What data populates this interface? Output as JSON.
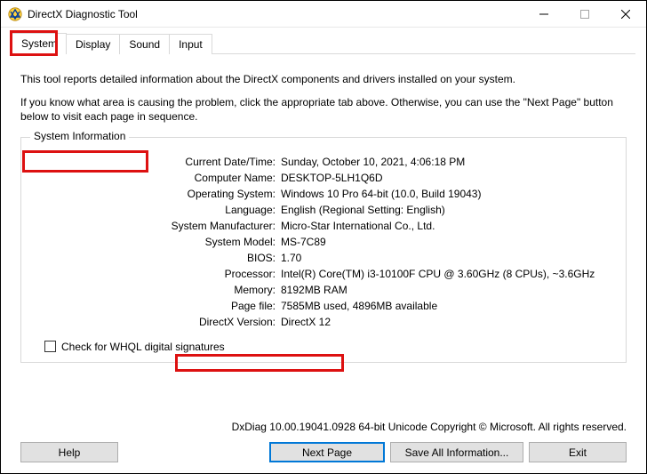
{
  "title": "DirectX Diagnostic Tool",
  "tabs": [
    "System",
    "Display",
    "Sound",
    "Input"
  ],
  "intro": {
    "p1": "This tool reports detailed information about the DirectX components and drivers installed on your system.",
    "p2": "If you know what area is causing the problem, click the appropriate tab above.  Otherwise, you can use the \"Next Page\" button below to visit each page in sequence."
  },
  "group": {
    "legend": "System Information"
  },
  "info": [
    {
      "label": "Current Date/Time:",
      "value": "Sunday, October 10, 2021, 4:06:18 PM"
    },
    {
      "label": "Computer Name:",
      "value": "DESKTOP-5LH1Q6D"
    },
    {
      "label": "Operating System:",
      "value": "Windows 10 Pro 64-bit (10.0, Build 19043)"
    },
    {
      "label": "Language:",
      "value": "English (Regional Setting: English)"
    },
    {
      "label": "System Manufacturer:",
      "value": "Micro-Star International Co., Ltd."
    },
    {
      "label": "System Model:",
      "value": "MS-7C89"
    },
    {
      "label": "BIOS:",
      "value": "1.70"
    },
    {
      "label": "Processor:",
      "value": "Intel(R) Core(TM) i3-10100F CPU @ 3.60GHz (8 CPUs), ~3.6GHz"
    },
    {
      "label": "Memory:",
      "value": "8192MB RAM"
    },
    {
      "label": "Page file:",
      "value": "7585MB used, 4896MB available"
    },
    {
      "label": "DirectX Version:",
      "value": "DirectX 12"
    }
  ],
  "checkbox": {
    "label": "Check for WHQL digital signatures"
  },
  "copy": "DxDiag 10.00.19041.0928 64-bit Unicode  Copyright © Microsoft. All rights reserved.",
  "buttons": {
    "help": "Help",
    "next": "Next Page",
    "save": "Save All Information...",
    "exit": "Exit"
  }
}
